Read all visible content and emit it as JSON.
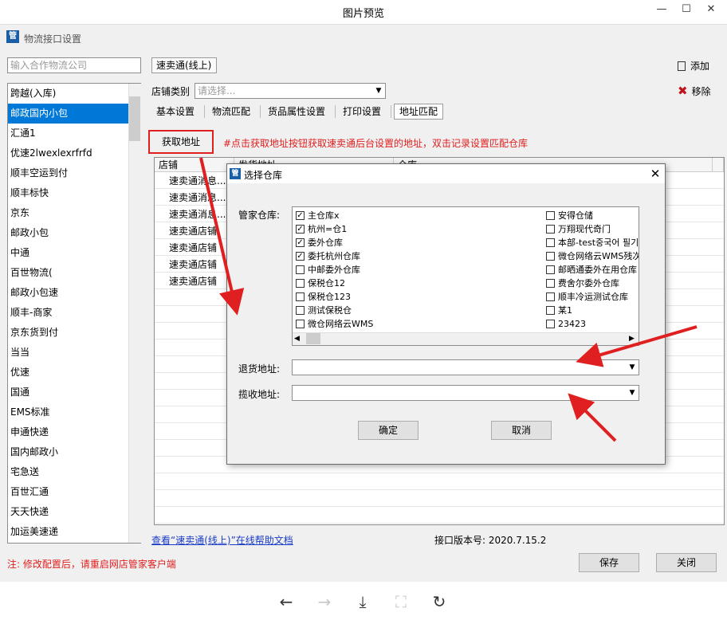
{
  "viewer": {
    "title": "图片预览",
    "minimize": "—",
    "maximize": "☐",
    "close": "✕",
    "toolbar": {
      "prev": "←",
      "next": "→",
      "download": "⤓",
      "fit": "⛶",
      "rotate": "↻"
    }
  },
  "app": {
    "icon_glyph": "管",
    "title": "物流接口设置",
    "search_placeholder": "输入合作物流公司",
    "companies": [
      "跨越(入库)",
      "邮政国内小包",
      "汇通1",
      "优速2lwexlexrfrfd",
      "顺丰空运到付",
      "顺丰标快",
      "京东",
      "邮政小包",
      "中通",
      "百世物流(",
      "邮政小包速",
      "顺丰-商家",
      "京东货到付",
      "当当",
      "优速",
      "国通",
      "EMS标准",
      "申通快递",
      "国内邮政小",
      "宅急送",
      "百世汇通",
      "天天快递",
      "加运美速递"
    ],
    "selected_company_index": 1,
    "platform_tab": "速卖通(线上)",
    "add_label": "添加",
    "remove_label": "移除",
    "shop_type_label": "店铺类别",
    "shop_type_placeholder": "请选择...",
    "subtabs": [
      "基本设置",
      "物流匹配",
      "货品属性设置",
      "打印设置",
      "地址匹配"
    ],
    "active_subtab": 4,
    "fetch_button": "获取地址",
    "fetch_hint": "#点击获取地址按钮获取速卖通后台设置的地址，双击记录设置匹配仓库",
    "grid": {
      "headers": [
        "店铺",
        "发货地址",
        "仓库"
      ],
      "rows": [
        "速卖通消息...",
        "速卖通消息...",
        "速卖通消息...",
        "速卖通店铺",
        "速卖通店铺",
        "速卖通店铺",
        "速卖通店铺"
      ]
    },
    "help_link": "查看“速卖通(线上)”在线帮助文档",
    "version": "接口版本号: 2020.7.15.2",
    "restart_note": "注: 修改配置后，请重启网店管家客户端",
    "save_button": "保存",
    "close_button": "关闭"
  },
  "warehouse_dialog": {
    "title": "选择仓库",
    "close": "✕",
    "warehouse_label": "管家仓库:",
    "left_column": [
      {
        "name": "主仓库x",
        "checked": true
      },
      {
        "name": "杭州=仓1",
        "checked": true
      },
      {
        "name": "委外仓库",
        "checked": true
      },
      {
        "name": "委托杭州仓库",
        "checked": true
      },
      {
        "name": "中邮委外仓库",
        "checked": false
      },
      {
        "name": "保税仓12",
        "checked": false
      },
      {
        "name": "保税仓123",
        "checked": false
      },
      {
        "name": "测试保税仓",
        "checked": false
      },
      {
        "name": "微仓网络云WMS",
        "checked": false
      }
    ],
    "right_column": [
      {
        "name": "安得仓储",
        "checked": false
      },
      {
        "name": "万翔现代奇门",
        "checked": false
      },
      {
        "name": "本部-test중국어 필기",
        "checked": false
      },
      {
        "name": "微仓网络云WMS残次",
        "checked": false
      },
      {
        "name": "邮晒通委外在用仓库",
        "checked": false
      },
      {
        "name": "费舍尔委外仓库",
        "checked": false
      },
      {
        "name": "顺丰冷运测试仓库",
        "checked": false
      },
      {
        "name": "某1",
        "checked": false
      },
      {
        "name": "23423",
        "checked": false
      }
    ],
    "return_label": "退货地址:",
    "pickup_label": "揽收地址:",
    "ok_button": "确定",
    "cancel_button": "取消"
  },
  "colors": {
    "accent": "#0078d7",
    "annotation": "#e02020",
    "link": "#1a3cc8"
  }
}
